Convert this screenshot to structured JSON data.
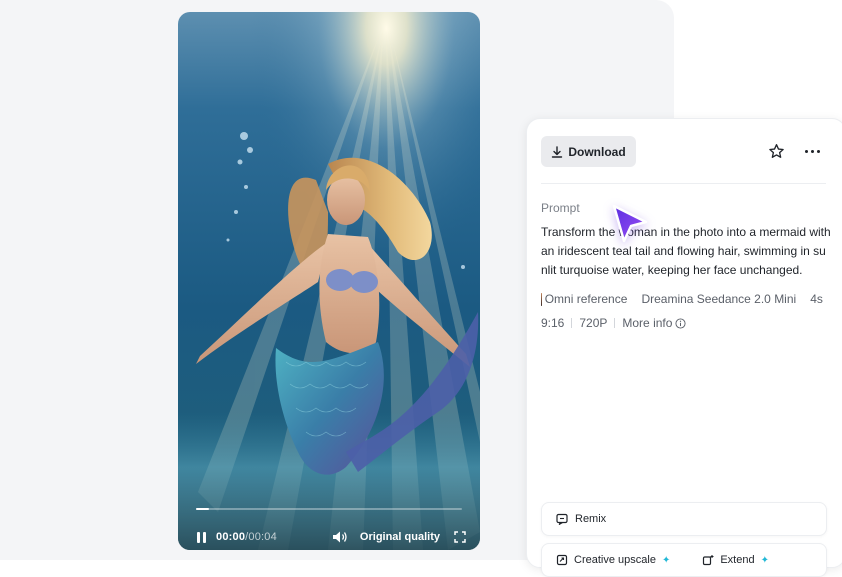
{
  "player": {
    "current_time": "00:00",
    "separator": "/",
    "duration": "00:04",
    "quality_label": "Original quality",
    "progress_fraction": 0.05
  },
  "panel": {
    "download_label": "Download",
    "prompt_label": "Prompt",
    "prompt_text": "Transform the woman in the photo into a mermaid with an iridescent teal tail and flowing hair, swimming in sunlit turquoise water, keeping her face unchanged.",
    "meta": {
      "reference": "Omni reference",
      "model": "Dreamina Seedance 2.0 Mini",
      "length": "4s",
      "ratio": "9:16",
      "resolution": "720P",
      "more_info": "More info"
    },
    "actions": {
      "remix": "Remix",
      "creative_upscale": "Creative upscale",
      "extend": "Extend"
    }
  },
  "colors": {
    "accent_cursor": "#7b3ff2",
    "sparkle": "#21b8d6"
  },
  "icons": [
    "download-icon",
    "star-icon",
    "more-icon",
    "info-icon",
    "remix-icon",
    "upscale-icon",
    "extend-icon",
    "pause-icon",
    "volume-icon",
    "fullscreen-icon"
  ]
}
